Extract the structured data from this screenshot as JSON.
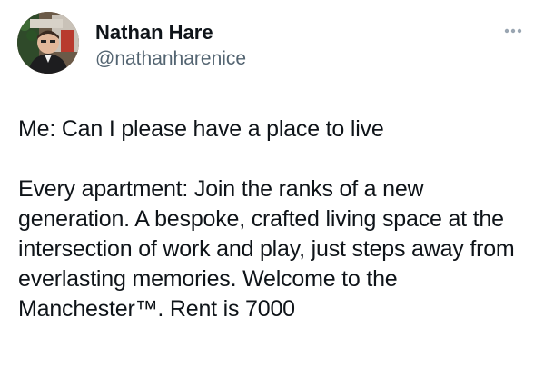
{
  "author": {
    "display_name": "Nathan Hare",
    "handle": "@nathanharenice",
    "avatar_icon": "profile-photo"
  },
  "menu": {
    "icon": "more-options-icon"
  },
  "post": {
    "paragraphs": [
      "Me: Can I please have a place to live",
      "Every apartment: Join the ranks of a new generation. A bespoke, crafted living space at the intersection of work and play, just steps away from everlasting memories. Welcome to the Manchester™. Rent is 7000"
    ]
  },
  "colors": {
    "text": "#0f1419",
    "secondary": "#536471",
    "background": "#ffffff"
  }
}
